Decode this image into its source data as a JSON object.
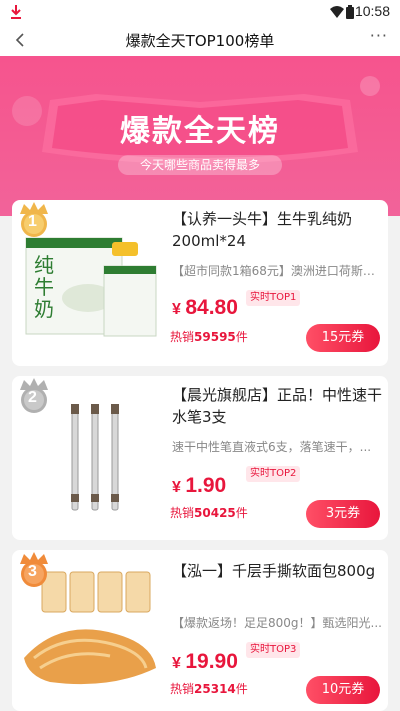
{
  "status_bar": {
    "time": "10:58",
    "icons": [
      "download-icon",
      "wifi-icon",
      "battery-icon"
    ]
  },
  "nav": {
    "title": "爆款全天TOP100榜单",
    "more_label": "···"
  },
  "banner": {
    "headline": "爆款全天榜",
    "subtitle": "今天哪些商品卖得最多"
  },
  "colors": {
    "brand_pink": "#f6548e",
    "price_red": "#e8163c",
    "rank_gold": "#f0b64b",
    "rank_silver": "#b0b0b0",
    "rank_bronze": "#f08b3a"
  },
  "products": [
    {
      "rank": "1",
      "name": "【认养一头牛】生牛乳纯奶200ml*24",
      "desc": "【超市同款1箱68元】澳洲进口荷斯坦...",
      "currency": "¥",
      "price": "84.80",
      "rank_tag": "实时TOP1",
      "sold_prefix": "热销",
      "sold_count": "59595",
      "sold_suffix": "件",
      "coupon": "15元券"
    },
    {
      "rank": "2",
      "name": "【晨光旗舰店】正品！中性速干水笔3支",
      "desc": "速干中性笔直液式6支，落笔速干，...",
      "currency": "¥",
      "price": "1.90",
      "rank_tag": "实时TOP2",
      "sold_prefix": "热销",
      "sold_count": "50425",
      "sold_suffix": "件",
      "coupon": "3元券"
    },
    {
      "rank": "3",
      "name": "【泓一】千层手撕软面包800g",
      "desc": "【爆款返场！足足800g！】甄选阳光...",
      "currency": "¥",
      "price": "19.90",
      "rank_tag": "实时TOP3",
      "sold_prefix": "热销",
      "sold_count": "25314",
      "sold_suffix": "件",
      "coupon": "10元券"
    }
  ]
}
